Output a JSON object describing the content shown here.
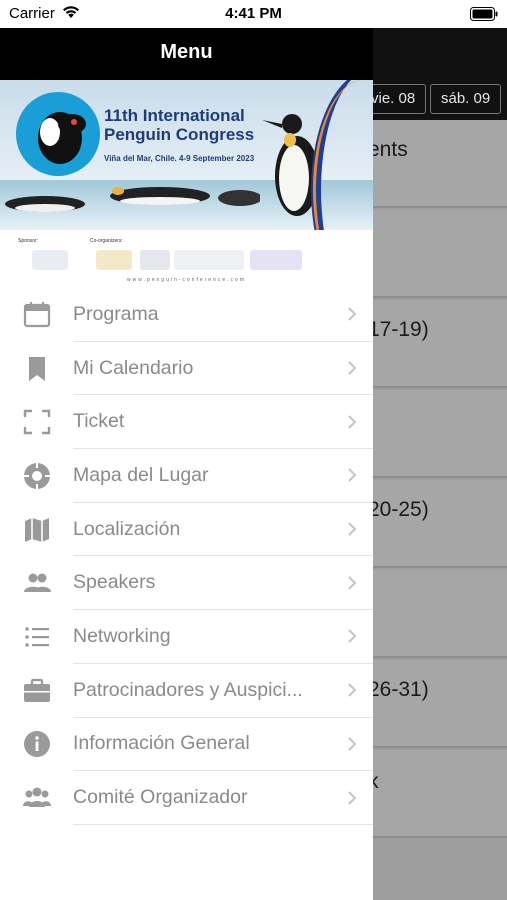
{
  "status_bar": {
    "carrier": "Carrier",
    "time": "4:41 PM"
  },
  "drawer": {
    "title": "Menu"
  },
  "banner": {
    "title_line1": "11th International",
    "title_line2": "Penguin Congress",
    "subtitle": "Viña del Mar, Chile. 4-9 September 2023",
    "sponsor_label": "Sponsor:",
    "coorganizers_label": "Co-organizers:",
    "url": "www.penguin-conference.com"
  },
  "menu": {
    "items": [
      {
        "label": "Programa",
        "icon": "calendar-icon"
      },
      {
        "label": "Mi Calendario",
        "icon": "bookmark-icon"
      },
      {
        "label": "Ticket",
        "icon": "scan-frame-icon"
      },
      {
        "label": "Mapa del Lugar",
        "icon": "target-icon"
      },
      {
        "label": "Localización",
        "icon": "map-icon"
      },
      {
        "label": "Speakers",
        "icon": "people-icon"
      },
      {
        "label": "Networking",
        "icon": "list-icon"
      },
      {
        "label": "Patrocinadores y Auspici...",
        "icon": "briefcase-icon"
      },
      {
        "label": "Información General",
        "icon": "info-icon"
      },
      {
        "label": "Comité Organizador",
        "icon": "group-icon"
      }
    ]
  },
  "background": {
    "day_chips": [
      "vie. 08",
      "sáb. 09"
    ],
    "row_texts": [
      "ents",
      "17-19)",
      "20-25)",
      "26-31)",
      "k"
    ]
  },
  "colors": {
    "drawer_header_bg": "#000000",
    "menu_text": "#8a8a8a",
    "icon_gray": "#9a9a9a",
    "banner_blue": "#1c3d7a"
  }
}
